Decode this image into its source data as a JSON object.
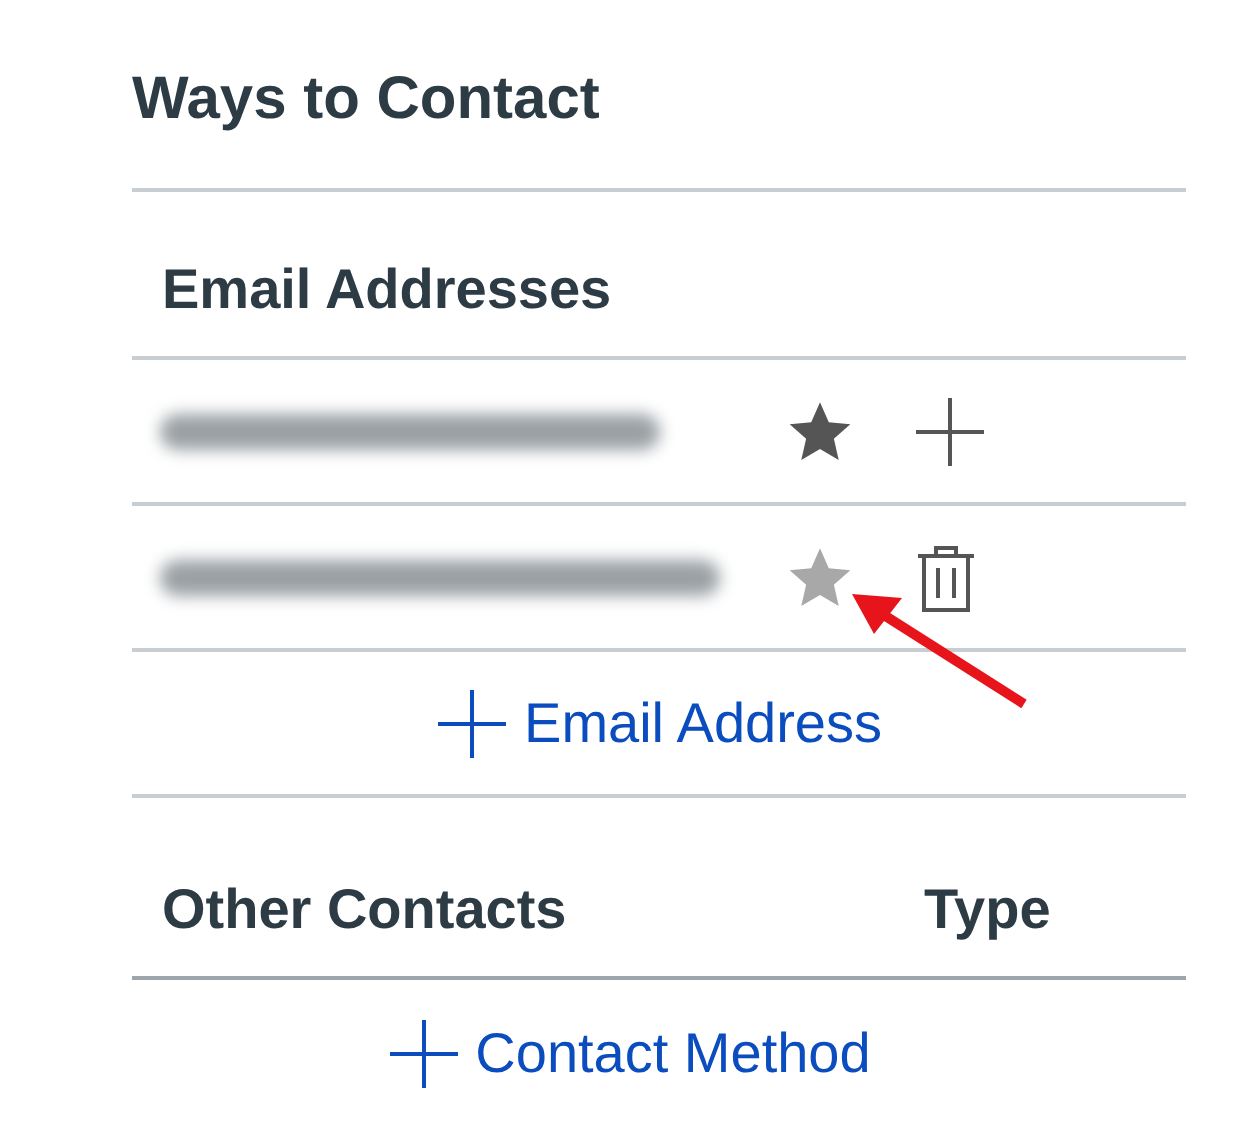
{
  "title": "Ways to Contact",
  "email_section": {
    "heading": "Email Addresses",
    "rows": [
      {
        "default": true,
        "kind": "add"
      },
      {
        "default": false,
        "kind": "delete"
      }
    ],
    "add_link": "Email Address"
  },
  "other_section": {
    "columns": [
      "Other Contacts",
      "Type"
    ],
    "add_link": "Contact Method"
  }
}
